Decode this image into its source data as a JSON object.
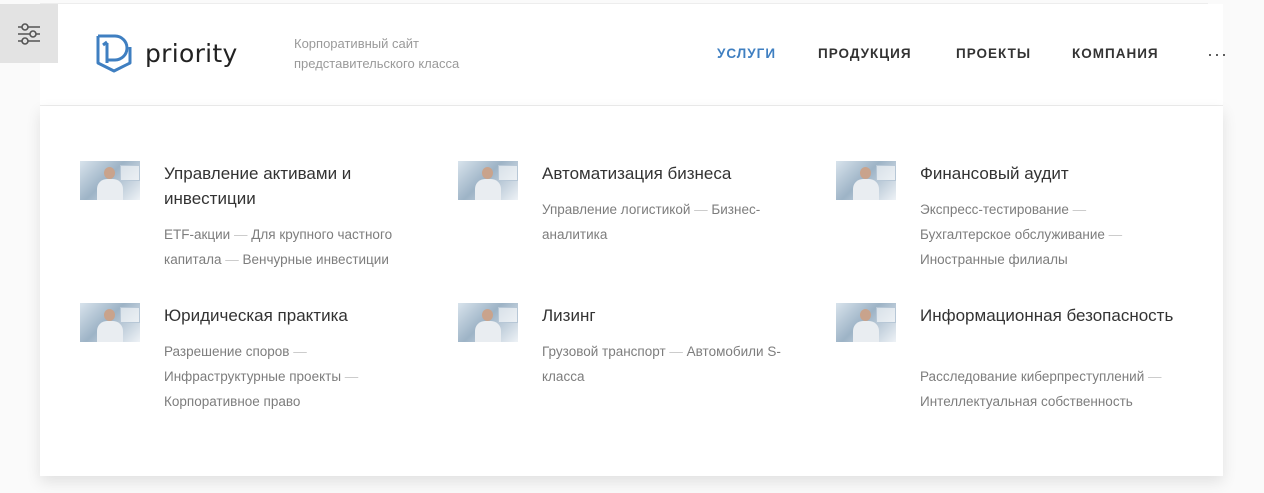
{
  "colors": {
    "accent": "#3f7fc1",
    "text": "#333333",
    "muted": "#7d7d7d"
  },
  "settings": {
    "icon": "sliders-icon"
  },
  "brand": {
    "logo_icon": "priority-logo-icon",
    "name": "priority"
  },
  "header": {
    "tagline_line1": "Корпоративный сайт",
    "tagline_line2": "представительского класса"
  },
  "nav": {
    "items": [
      {
        "label": "УСЛУГИ",
        "active": true
      },
      {
        "label": "ПРОДУКЦИЯ",
        "active": false
      },
      {
        "label": "ПРОЕКТЫ",
        "active": false
      },
      {
        "label": "КОМПАНИЯ",
        "active": false
      }
    ],
    "more": "···"
  },
  "services": [
    {
      "title": "Управление активами и инвестиции",
      "links": [
        "ETF-акции",
        "Для крупного частного капитала",
        "Венчурные инвестиции"
      ]
    },
    {
      "title": "Автоматизация бизнеса",
      "links": [
        "Управление логистикой",
        "Бизнес-аналитика"
      ]
    },
    {
      "title": "Финансовый аудит",
      "links": [
        "Экспресс-тестирование",
        "Бухгалтерское обслуживание",
        "Иностранные филиалы"
      ]
    },
    {
      "title": "Юридическая практика",
      "links": [
        "Разрешение споров",
        "Инфраструктурные проекты",
        "Корпоративное право"
      ]
    },
    {
      "title": "Лизинг",
      "links": [
        "Грузовой транспорт",
        "Автомобили S-класса"
      ]
    },
    {
      "title": "Информационная безопасность",
      "links": [
        "Расследование киберпреступлений",
        "Интеллектуальная собственность"
      ]
    }
  ]
}
